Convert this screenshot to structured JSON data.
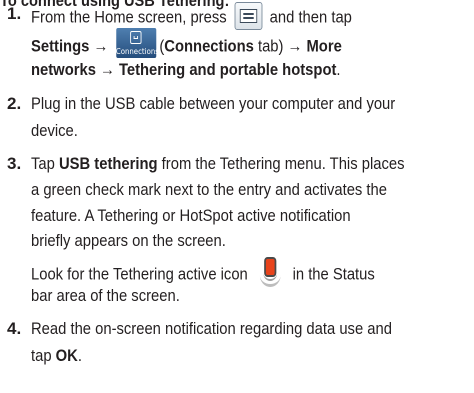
{
  "heading": "To connect using USB Tethering:",
  "steps": [
    {
      "number": "1.",
      "line1_a": "From the Home screen, press",
      "line1_b": "and then tap",
      "line2_a": "Settings →",
      "line2_b": "(",
      "line2_c": "Connections",
      "line2_d": " tab) → ",
      "line2_e": "More",
      "line3": "networks → Tethering and portable hotspot",
      "line3_end": "."
    },
    {
      "number": "2.",
      "line1": "Plug in the USB cable between your computer and your",
      "line2": "device."
    },
    {
      "number": "3.",
      "line1_a": "Tap ",
      "line1_b": "USB tethering",
      "line1_c": " from the Tethering menu. This places",
      "line2": "a green check mark next to the entry and activates the",
      "line3": "feature. A Tethering or HotSpot active notification",
      "line4": "briefly appears on the screen.",
      "line5_a": "Look for the Tethering active icon",
      "line5_b": "in the Status",
      "line6": "bar area of the screen."
    },
    {
      "number": "4.",
      "line1": "Read the on-screen notification regarding data use and",
      "line2_a": "tap ",
      "line2_b": "OK",
      "line2_c": "."
    }
  ],
  "icons": {
    "menu_key": "menu-key-icon",
    "connections_tab": "connections-tab-icon",
    "connections_tab_label": "Connections",
    "tethering_active": "tethering-active-icon"
  }
}
